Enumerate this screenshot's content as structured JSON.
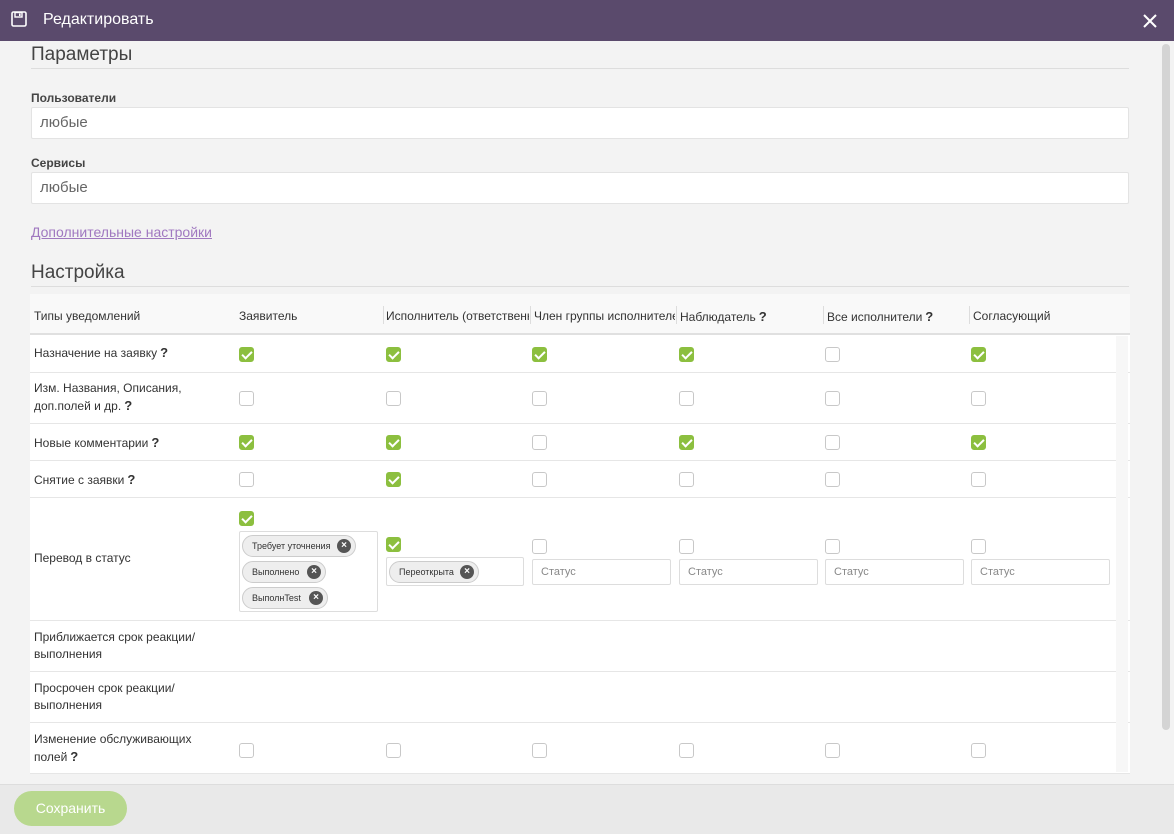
{
  "dialog": {
    "title": "Редактировать",
    "save_icon": "floppy-disk-icon",
    "close_icon": "close-icon",
    "header_color": "#5a4a6c"
  },
  "params": {
    "title": "Параметры",
    "users_label": "Пользователи",
    "users_value": "любые",
    "services_label": "Сервисы",
    "services_value": "любые",
    "advanced_link": "Дополнительные настройки"
  },
  "setup": {
    "title": "Настройка",
    "columns": [
      {
        "label": "Типы уведомлений",
        "help": ""
      },
      {
        "label": "Заявитель",
        "help": ""
      },
      {
        "label": "Исполнитель (ответственный)",
        "help": ""
      },
      {
        "label": "Член группы исполнителей",
        "help": ""
      },
      {
        "label": "Наблюдатель",
        "help": "?"
      },
      {
        "label": "Все исполнители",
        "help": "?"
      },
      {
        "label": "Согласующий",
        "help": ""
      }
    ],
    "rows": [
      {
        "label": "Назначение на заявку",
        "help": "?",
        "checks": [
          true,
          true,
          true,
          true,
          false,
          true
        ]
      },
      {
        "label": "Изм. Названия, Описания, доп.полей и др.",
        "help": "?",
        "checks": [
          false,
          false,
          false,
          false,
          false,
          false
        ]
      },
      {
        "label": "Новые комментарии",
        "help": "?",
        "checks": [
          true,
          true,
          false,
          true,
          false,
          true
        ]
      },
      {
        "label": "Снятие с заявки",
        "help": "?",
        "checks": [
          false,
          true,
          false,
          false,
          false,
          false
        ]
      },
      {
        "label": "Перевод в статус",
        "help": "",
        "checks": [
          true,
          true,
          false,
          false,
          false,
          false
        ]
      },
      {
        "label": "Приближается срок реакции/ выполнения",
        "help": "",
        "checks": []
      },
      {
        "label": "Просрочен срок реакции/ выполнения",
        "help": "",
        "checks": []
      },
      {
        "label": "Изменение обслуживающих полей",
        "help": "?",
        "checks": [
          false,
          false,
          false,
          false,
          false,
          false
        ]
      }
    ],
    "status_tags_applicant": [
      "Требует уточнения",
      "Выполнено",
      "ВыполнTest"
    ],
    "status_tags_executor": [
      "Переоткрыта"
    ],
    "status_placeholder": "Статус",
    "remove_icon": "remove-tag-icon"
  },
  "footer": {
    "save_label": "Сохранить"
  },
  "colors": {
    "accent": "#8cbf3f",
    "link": "#a078c0",
    "save_button": "#b8d88e"
  }
}
